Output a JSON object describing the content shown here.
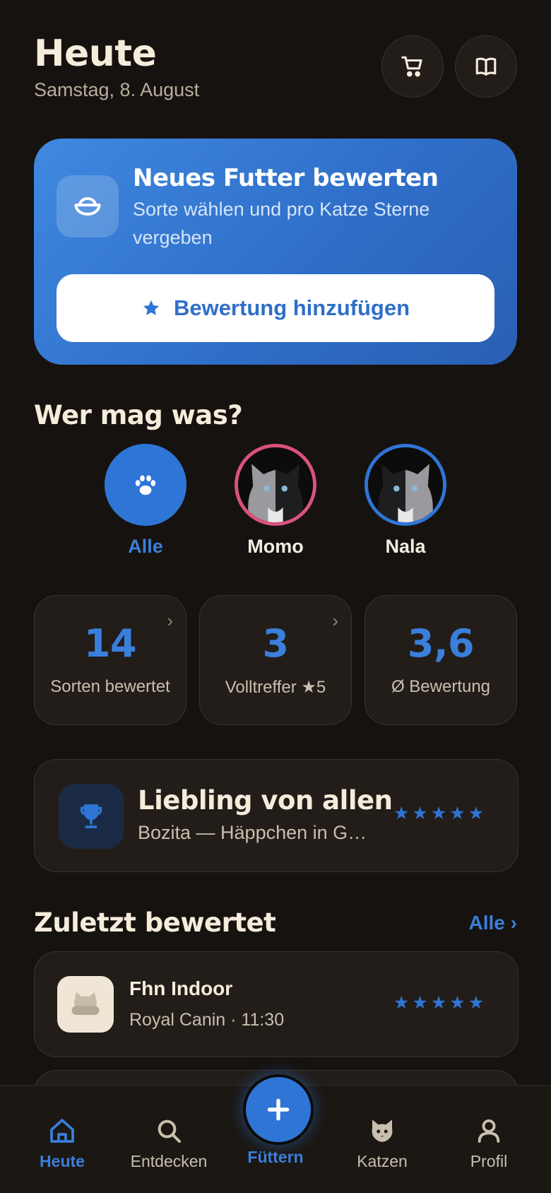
{
  "header": {
    "title": "Heute",
    "date": "Samstag, 8. August",
    "cart_icon": "cart-icon",
    "book_icon": "book-open-icon"
  },
  "hero": {
    "title": "Neues Futter bewerten",
    "subtitle": "Sorte wählen und pro Katze Sterne vergeben",
    "button_label": "Bewertung hinzufügen",
    "icon": "bowl-icon",
    "button_icon": "star-icon"
  },
  "cats_section": {
    "title": "Wer mag was?",
    "cats": [
      {
        "label": "Alle",
        "selected": true,
        "icon": "paw-icon"
      },
      {
        "label": "Momo",
        "selected": false,
        "ring_color": "#d9527d"
      },
      {
        "label": "Nala",
        "selected": false,
        "ring_color": "#2f75d6"
      }
    ]
  },
  "stats": [
    {
      "value": "14",
      "label": "Sorten bewertet"
    },
    {
      "value": "3",
      "label": "Volltreffer ★5"
    },
    {
      "value": "3,6",
      "label": "Ø Bewertung"
    }
  ],
  "favorite": {
    "title": "Liebling von allen",
    "subtitle": "Bozita — Häppchen in G…",
    "rating": 5,
    "icon": "trophy-icon"
  },
  "recent": {
    "title": "Zuletzt bewertet",
    "all_label": "Alle ›",
    "items": [
      {
        "name": "Fhn Indoor",
        "meta": "Royal Canin · 11:30",
        "rating": 5
      }
    ]
  },
  "nav": {
    "items": [
      {
        "label": "Heute",
        "active": true,
        "icon": "home-icon"
      },
      {
        "label": "Entdecken",
        "active": false,
        "icon": "search-icon"
      },
      {
        "label": "Füttern",
        "active": false,
        "icon": "plus-icon"
      },
      {
        "label": "Katzen",
        "active": false,
        "icon": "cat-icon"
      },
      {
        "label": "Profil",
        "active": false,
        "icon": "user-icon"
      }
    ]
  },
  "colors": {
    "accent": "#2f75d6",
    "background": "#16120f",
    "card": "#221d19"
  }
}
